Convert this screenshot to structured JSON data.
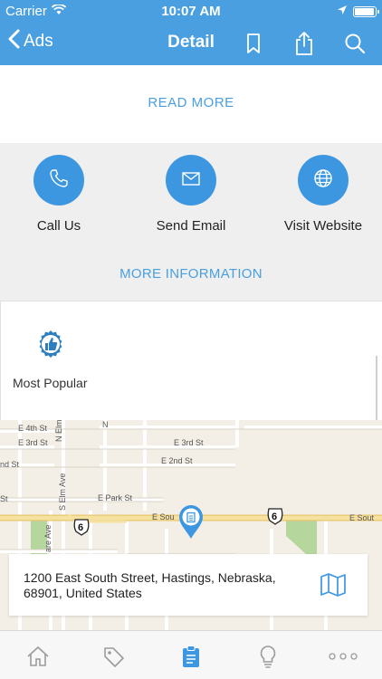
{
  "status": {
    "carrier": "Carrier",
    "time": "10:07 AM"
  },
  "nav": {
    "back_label": "Ads",
    "title": "Detail"
  },
  "content": {
    "read_more": "READ MORE",
    "actions": [
      {
        "label": "Call Us",
        "icon": "phone-icon"
      },
      {
        "label": "Send Email",
        "icon": "envelope-icon"
      },
      {
        "label": "Visit Website",
        "icon": "globe-icon"
      }
    ],
    "more_information": "MORE INFORMATION",
    "popular_label": "Most Popular"
  },
  "map": {
    "labels": {
      "e4th": "E 4th St",
      "e3rd_left": "E 3rd St",
      "e3rd_right": "E 3rd St",
      "e2nd_left": "nd St",
      "e2nd_right": "E 2nd St",
      "st_left": "St",
      "epark": "E Park St",
      "esou_left": "E Sou",
      "esou_right": "E Sout",
      "nelm": "N Elm Ave",
      "selm": "S Elm Ave",
      "are": "are Ave",
      "n": "N",
      "shield_left": "6",
      "shield_right": "6"
    },
    "address": "1200 East South Street, Hastings, Nebraska, 68901, United States"
  },
  "tabs": [
    {
      "icon": "home-icon"
    },
    {
      "icon": "tag-icon"
    },
    {
      "icon": "clipboard-icon"
    },
    {
      "icon": "lightbulb-icon"
    },
    {
      "icon": "more-dots-icon"
    }
  ],
  "colors": {
    "primary": "#4a9fe0",
    "action": "#3d97e0",
    "road_yellow": "#f2d98a",
    "park": "#a8d08d"
  }
}
